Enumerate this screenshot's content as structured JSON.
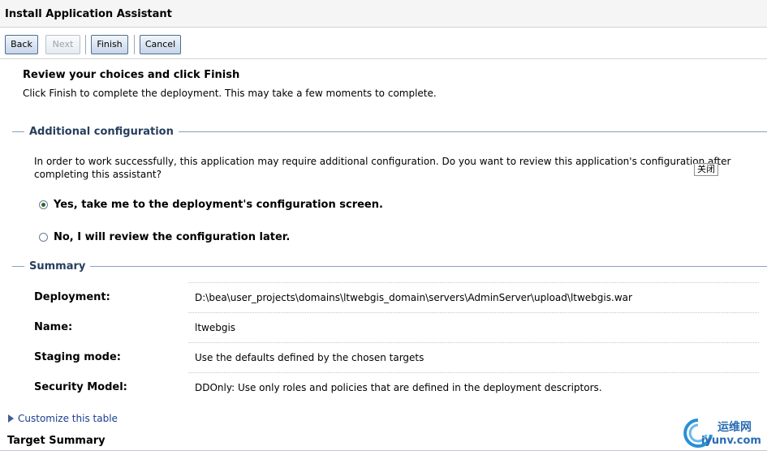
{
  "window": {
    "title": "Install Application Assistant"
  },
  "toolbar": {
    "back_label": "Back",
    "next_label": "Next",
    "finish_label": "Finish",
    "cancel_label": "Cancel"
  },
  "intro": {
    "heading": "Review your choices and click Finish",
    "text": "Click Finish to complete the deployment. This may take a few moments to complete."
  },
  "additional_config": {
    "title": "Additional configuration",
    "description": "In order to work successfully, this application may require additional configuration. Do you want to review this application's configuration after completing this assistant?",
    "options": [
      {
        "label": "Yes, take me to the deployment's configuration screen.",
        "selected": true
      },
      {
        "label": "No, I will review the configuration later.",
        "selected": false
      }
    ]
  },
  "close_tooltip": "关闭",
  "summary": {
    "title": "Summary",
    "rows": [
      {
        "label": "Deployment:",
        "value": "D:\\bea\\user_projects\\domains\\ltwebgis_domain\\servers\\AdminServer\\upload\\ltwebgis.war"
      },
      {
        "label": "Name:",
        "value": "ltwebgis"
      },
      {
        "label": "Staging mode:",
        "value": "Use the defaults defined by the chosen targets"
      },
      {
        "label": "Security Model:",
        "value": "DDOnly: Use only roles and policies that are defined in the deployment descriptors."
      }
    ]
  },
  "customize_link": "Customize this table",
  "target_summary_title": "Target Summary",
  "watermark": {
    "cn": "运维网",
    "en": "iyunv.com"
  },
  "colors": {
    "section_title": "#273e5e",
    "section_line": "#8aa0c0",
    "link": "#1a3d8f",
    "radio_selected": "#2a6a2a"
  }
}
